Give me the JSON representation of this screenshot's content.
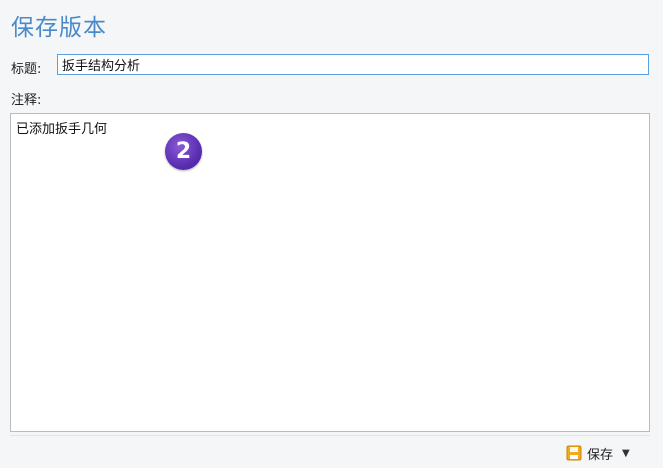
{
  "panel": {
    "title": "保存版本"
  },
  "form": {
    "title_label": "标题:",
    "title_value": "扳手结构分析",
    "notes_label": "注释:",
    "notes_value": "已添加扳手几何"
  },
  "badge": {
    "number": "2",
    "color": "#5a2fb0"
  },
  "toolbar": {
    "save_label": "保存",
    "save_icon": "floppy-disk-icon",
    "dropdown_icon": "caret-down-icon"
  },
  "colors": {
    "accent": "#4a8ac8",
    "input_border": "#5aa0dc",
    "save_icon": "#f2a91c"
  }
}
